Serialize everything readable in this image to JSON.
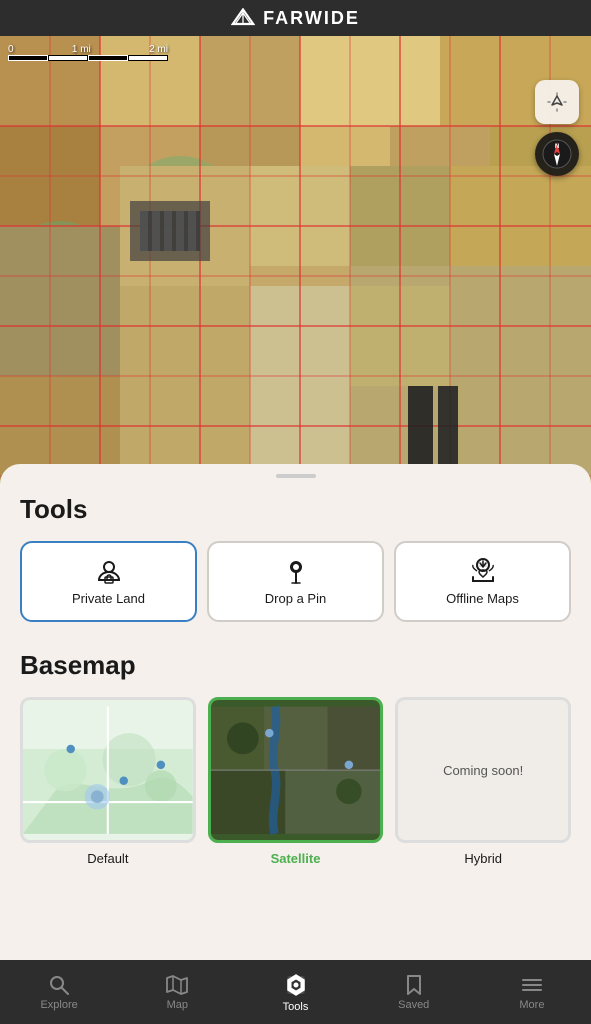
{
  "app": {
    "name": "FARWIDE"
  },
  "header": {
    "title": "FARWIDE"
  },
  "map": {
    "scale": {
      "labels": [
        "0",
        "1 mi",
        "2 mi"
      ]
    }
  },
  "tools": {
    "section_title": "Tools",
    "buttons": [
      {
        "id": "private-land",
        "label": "Private Land",
        "active": true
      },
      {
        "id": "drop-pin",
        "label": "Drop a Pin",
        "active": false
      },
      {
        "id": "offline-maps",
        "label": "Offline Maps",
        "active": false
      }
    ]
  },
  "basemap": {
    "section_title": "Basemap",
    "options": [
      {
        "id": "default",
        "label": "Default",
        "selected": false
      },
      {
        "id": "satellite",
        "label": "Satellite",
        "selected": true
      },
      {
        "id": "hybrid",
        "label": "Hybrid",
        "selected": false,
        "coming_soon": "Coming soon!"
      }
    ]
  },
  "nav": {
    "items": [
      {
        "id": "explore",
        "label": "Explore",
        "active": false
      },
      {
        "id": "map",
        "label": "Map",
        "active": false
      },
      {
        "id": "tools",
        "label": "Tools",
        "active": true
      },
      {
        "id": "saved",
        "label": "Saved",
        "active": false
      },
      {
        "id": "more",
        "label": "More",
        "active": false
      }
    ]
  },
  "colors": {
    "accent_blue": "#4a90d9",
    "accent_green": "#4CAF50",
    "active_white": "#ffffff",
    "inactive_gray": "#888888",
    "land_overlay": "rgba(220, 60, 60, 0.5)"
  }
}
